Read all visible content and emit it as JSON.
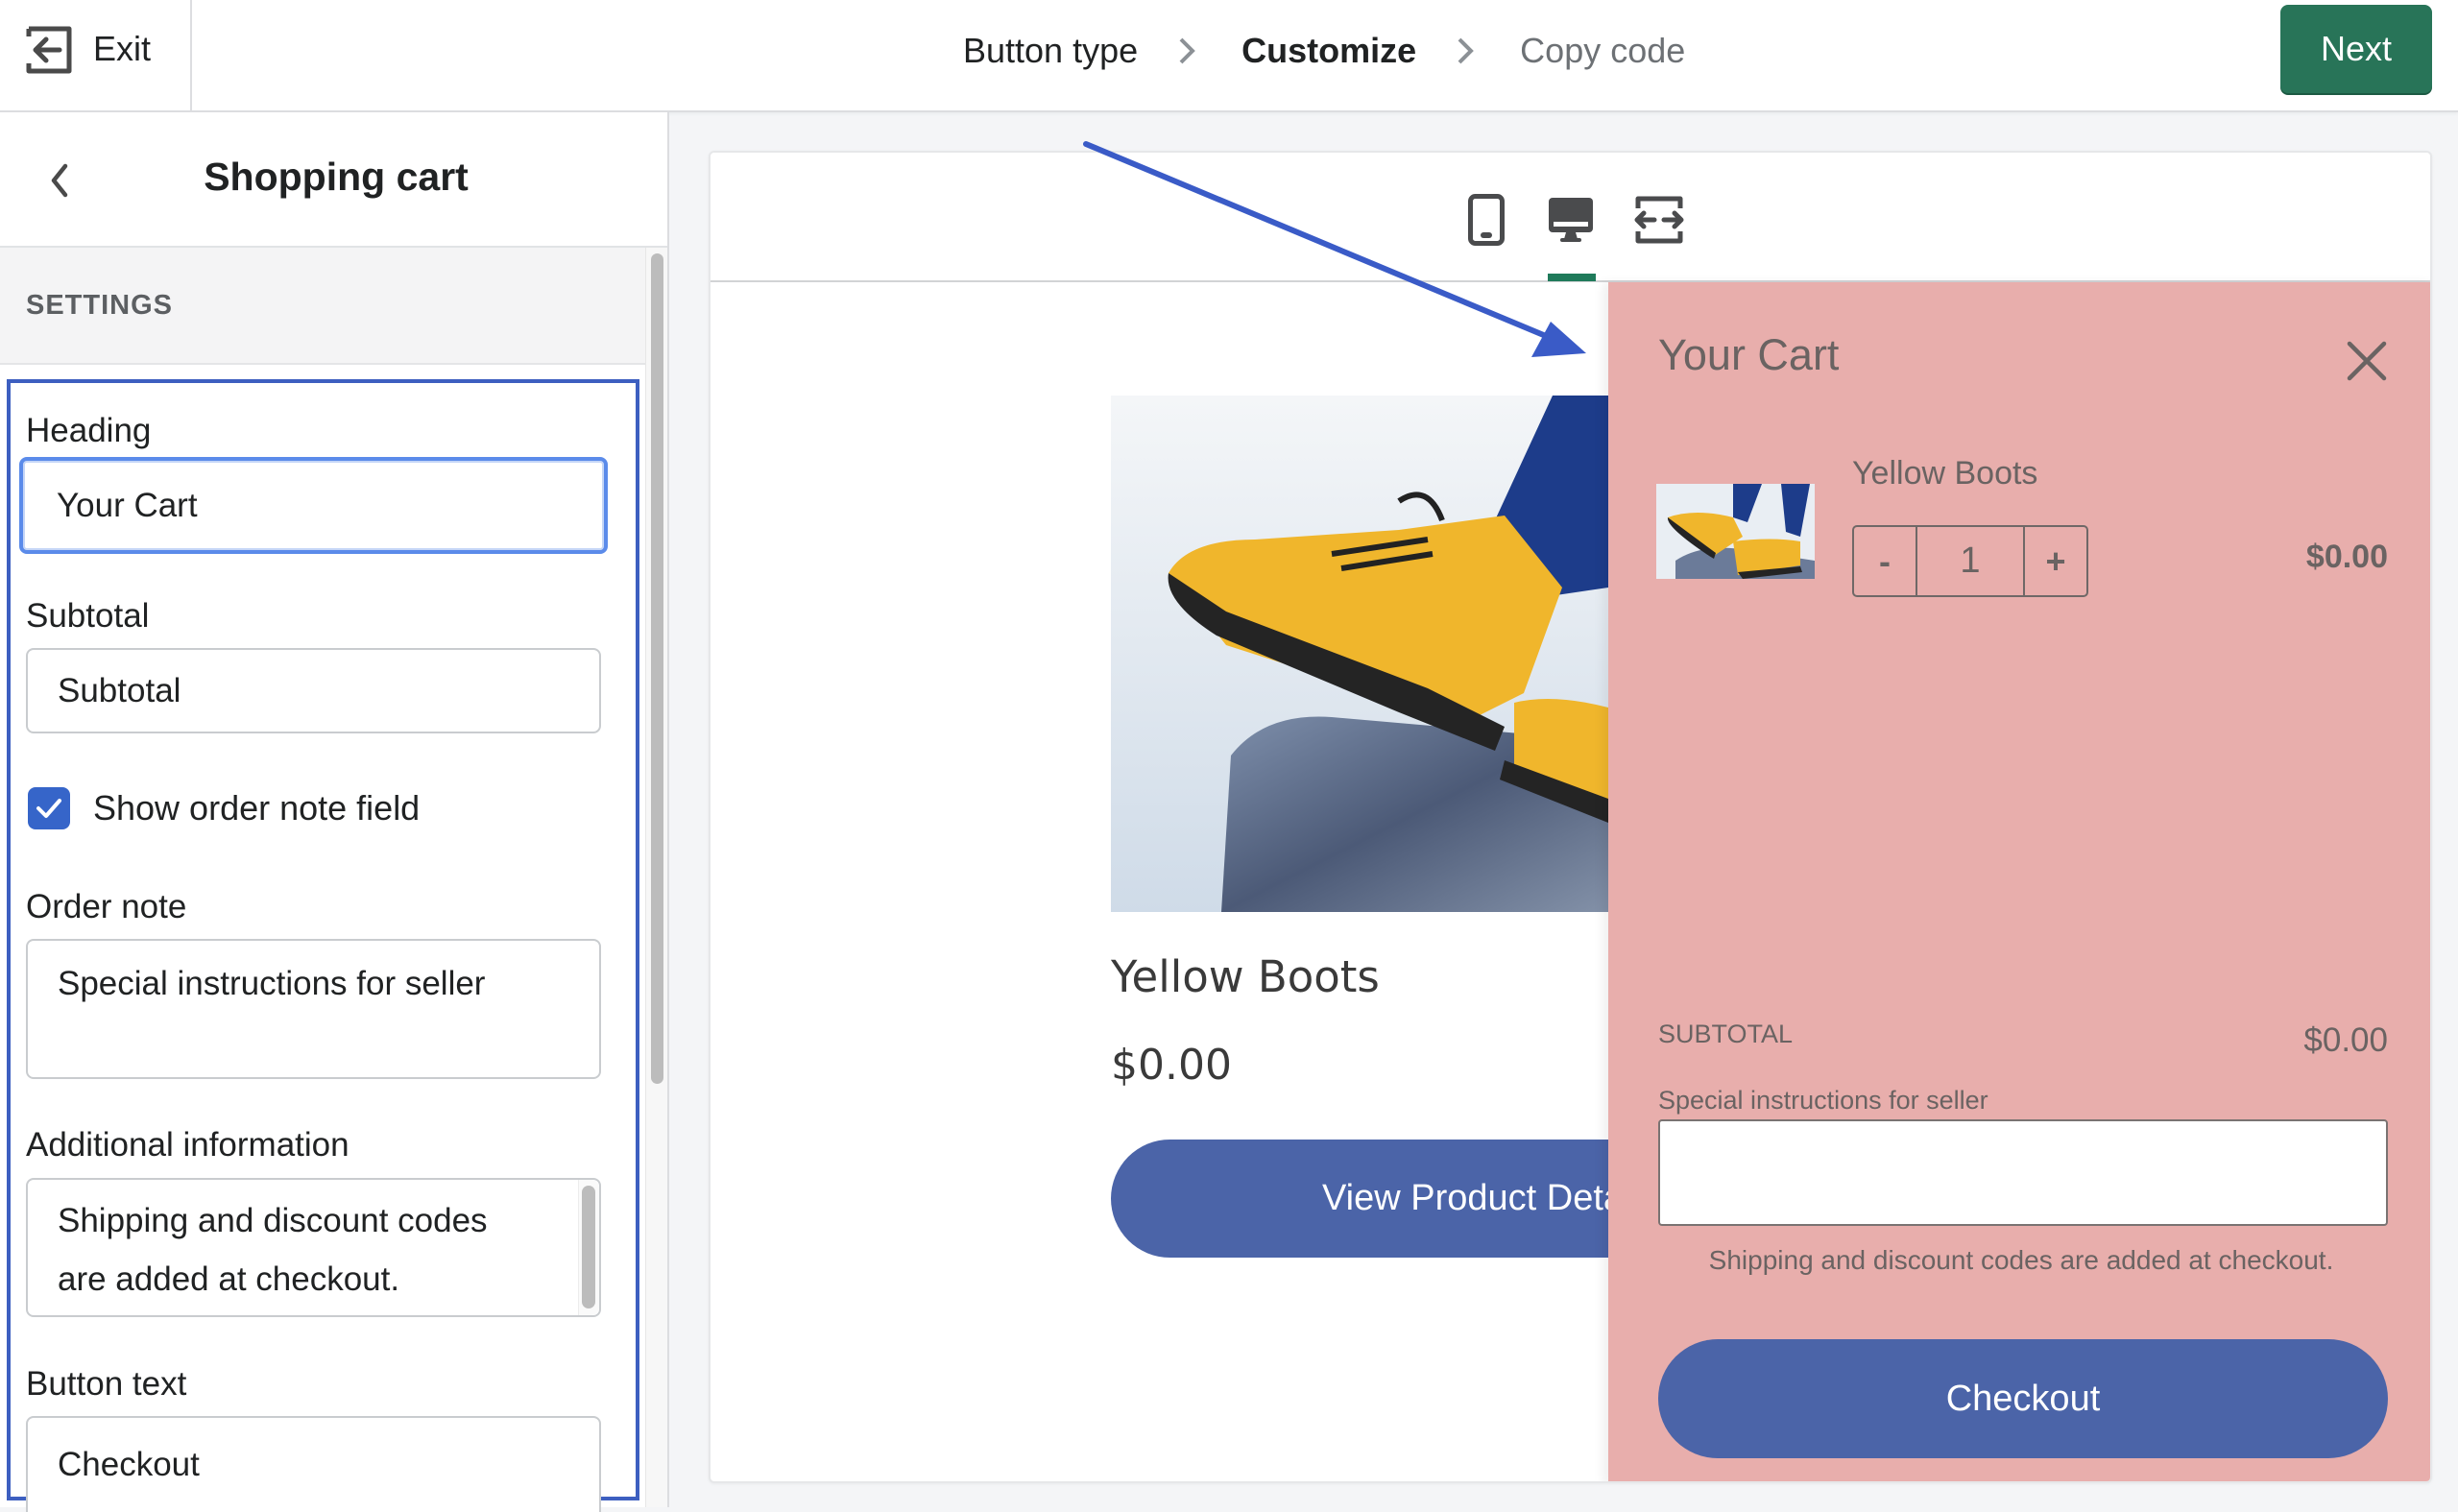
{
  "topbar": {
    "exit_label": "Exit",
    "exit_icon": "exit-arrow-icon",
    "breadcrumb": [
      {
        "label": "Button type",
        "state": "done"
      },
      {
        "label": "Customize",
        "state": "active"
      },
      {
        "label": "Copy code",
        "state": "future"
      }
    ],
    "next_label": "Next"
  },
  "sidebar": {
    "back_icon": "chevron-left-icon",
    "title": "Shopping cart",
    "section_label": "SETTINGS",
    "fields": {
      "heading": {
        "label": "Heading",
        "value": "Your Cart"
      },
      "subtotal": {
        "label": "Subtotal",
        "value": "Subtotal"
      },
      "show_order_note": {
        "label": "Show order note field",
        "checked": true
      },
      "order_note": {
        "label": "Order note",
        "value": "Special instructions for seller"
      },
      "additional_info": {
        "label": "Additional information",
        "value": "Shipping and discount codes are added at checkout."
      },
      "button_text": {
        "label": "Button text",
        "value": "Checkout"
      }
    }
  },
  "preview": {
    "view_modes": [
      {
        "name": "mobile",
        "icon": "mobile-phone-icon",
        "active": false
      },
      {
        "name": "desktop",
        "icon": "desktop-monitor-icon",
        "active": true
      },
      {
        "name": "full-width",
        "icon": "expand-horizontal-icon",
        "active": false
      }
    ],
    "product": {
      "name": "Yellow Boots",
      "price": "$0.00",
      "button_label": "View Product Details"
    },
    "cart": {
      "title": "Your Cart",
      "items": [
        {
          "name": "Yellow Boots",
          "quantity": "1",
          "price": "$0.00",
          "decrement": "-",
          "increment": "+"
        }
      ],
      "subtotal_label": "SUBTOTAL",
      "subtotal_value": "$0.00",
      "note_label": "Special instructions for seller",
      "note_value": "",
      "info_text": "Shipping and discount codes are added at checkout.",
      "checkout_label": "Checkout",
      "background_color": "#e8aeac",
      "button_color": "#4b64a8"
    }
  },
  "colors": {
    "primary_green": "#287458",
    "highlight_blue": "#3d5fc0",
    "checkbox_blue": "#3665c9",
    "annotation_arrow": "#3a5bc7"
  }
}
